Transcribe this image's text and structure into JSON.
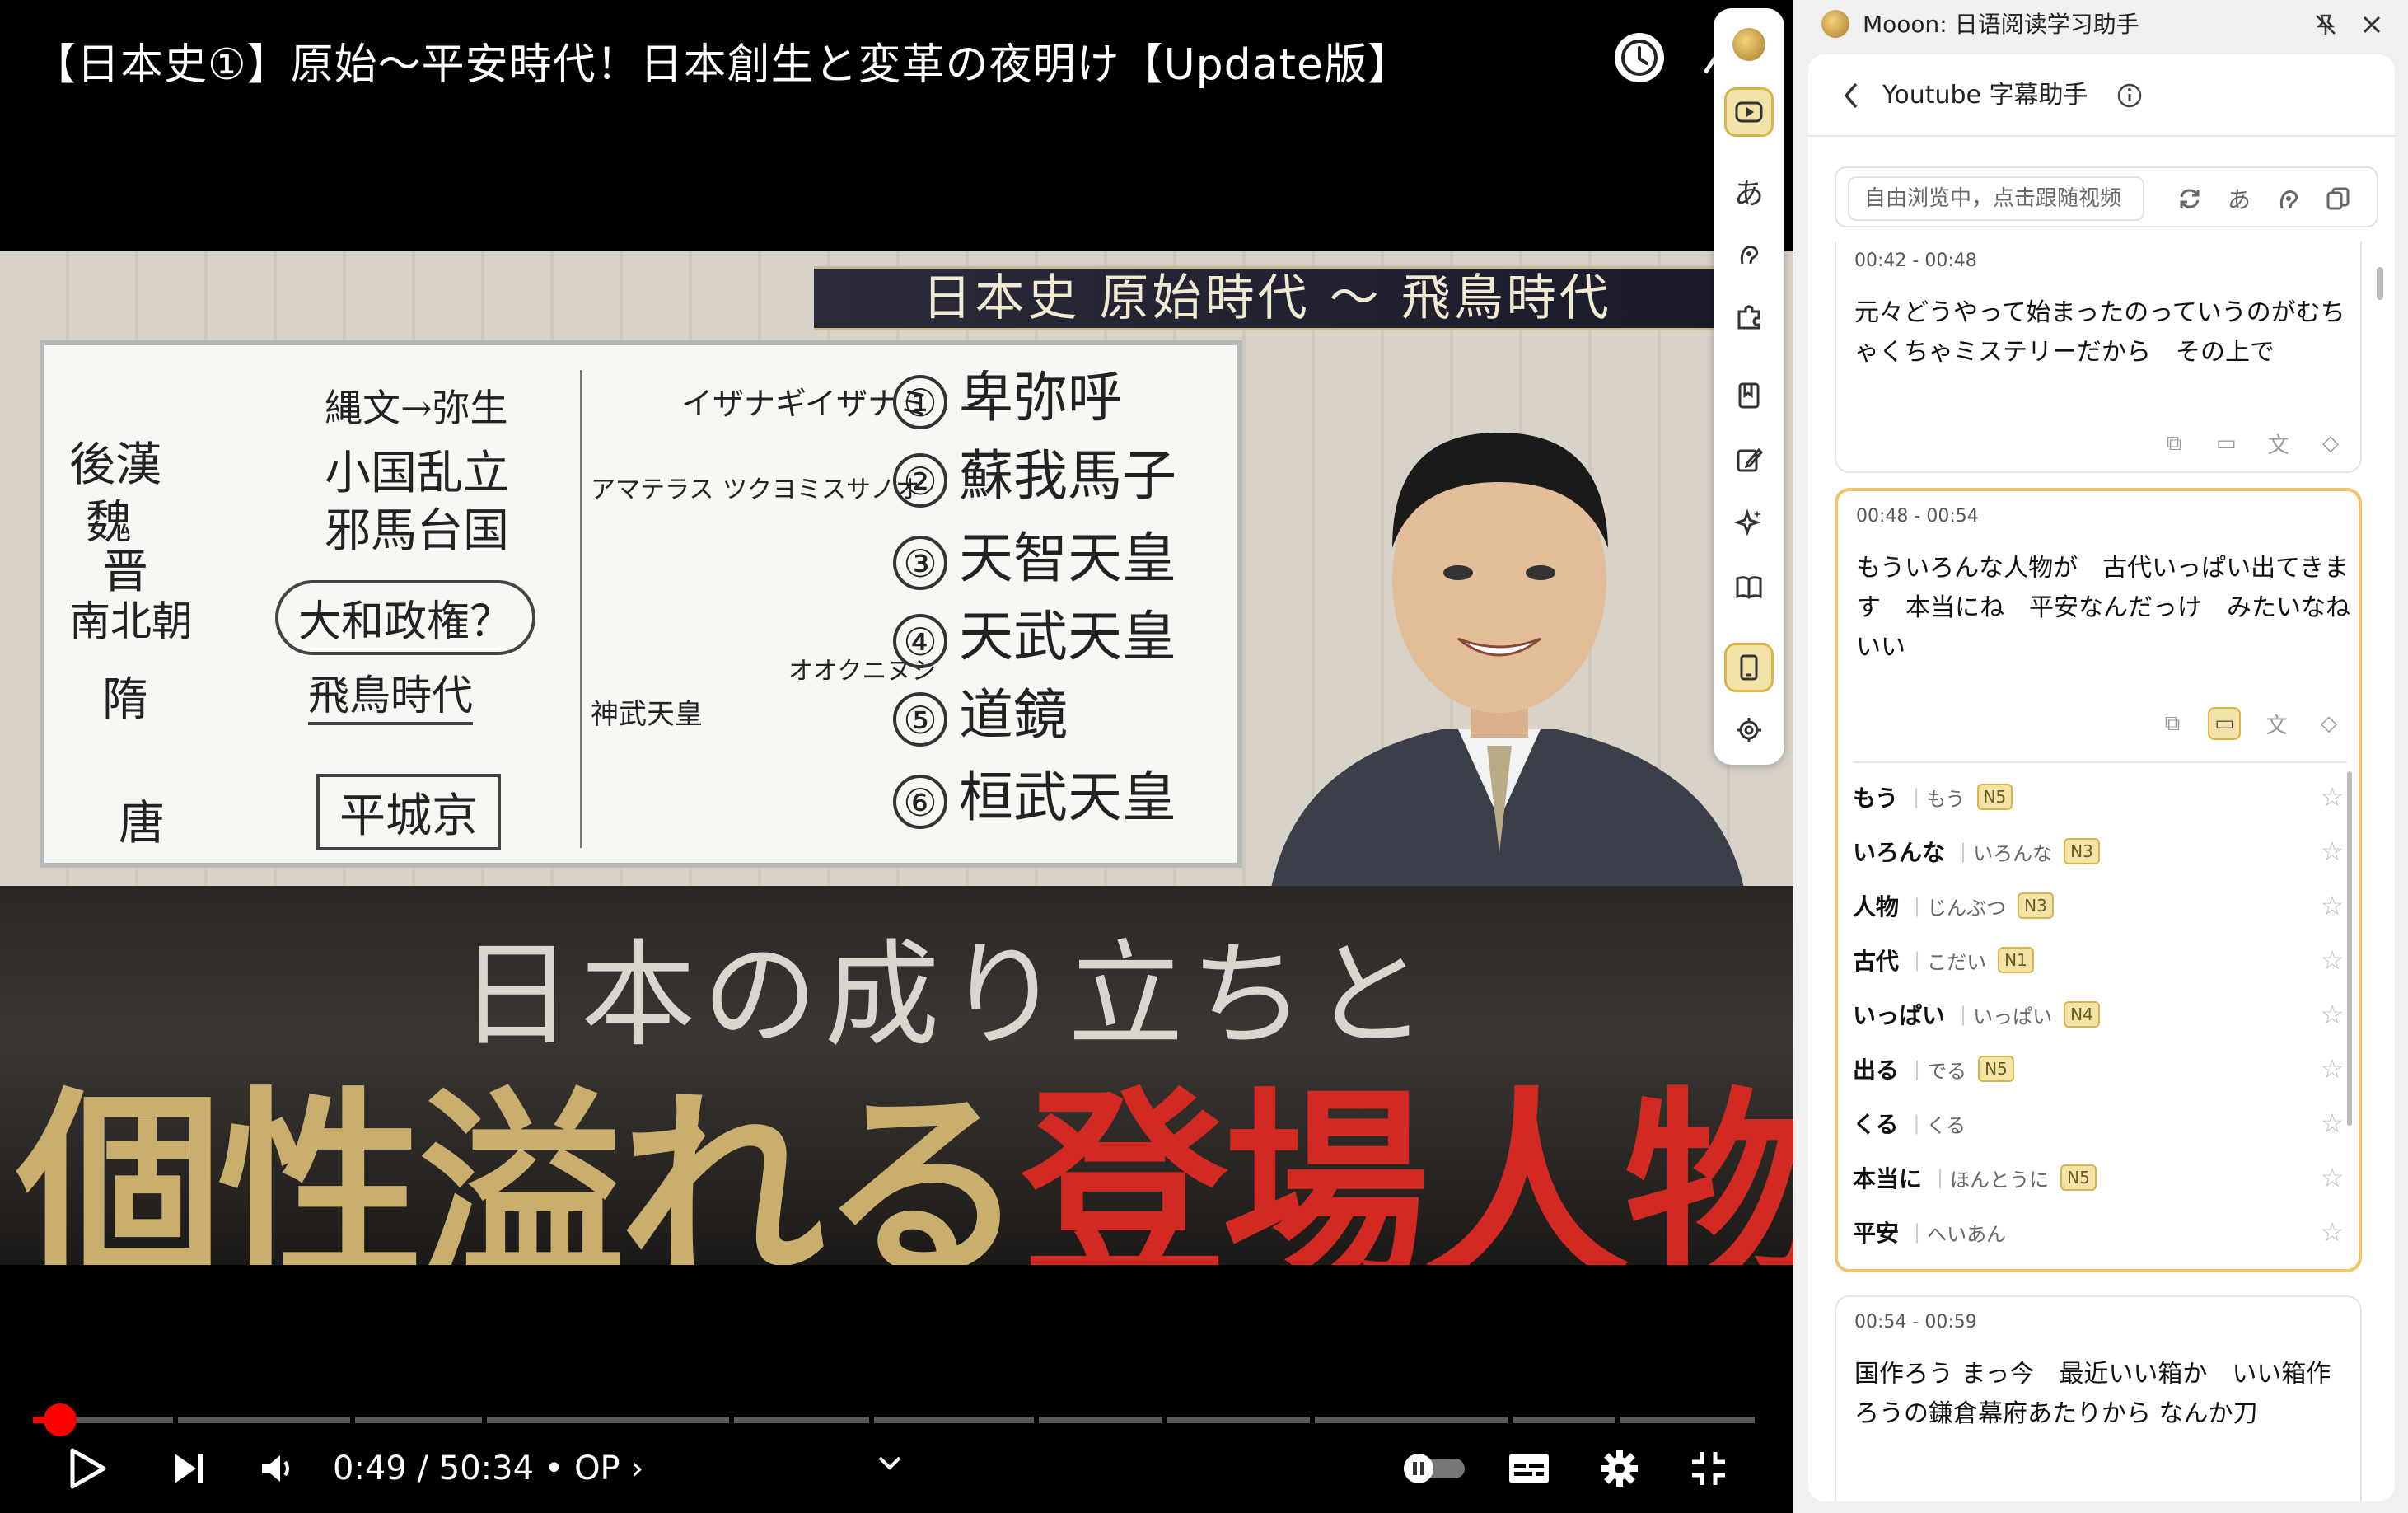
{
  "video": {
    "title": "【日本史①】原始〜平安時代！日本創生と変革の夜明け【Update版】",
    "banner": "日本史 原始時代 〜 飛鳥時代",
    "board_left": [
      "縄文→弥生",
      "後漢",
      "小国乱立",
      "魏",
      "邪馬台国",
      "晋",
      "南北朝",
      "大和政権？",
      "隋",
      "飛鳥時代",
      "唐",
      "平城京"
    ],
    "board_mid": [
      "イザナギ",
      "イザナミ",
      "アマテラス",
      "ツクヨミ",
      "スサノオ",
      "神武天皇",
      "オオクニヌシ"
    ],
    "board_right": [
      {
        "num": "①",
        "name": "卑弥呼"
      },
      {
        "num": "②",
        "name": "蘇我馬子"
      },
      {
        "num": "③",
        "name": "天智天皇"
      },
      {
        "num": "④",
        "name": "天武天皇"
      },
      {
        "num": "⑤",
        "name": "道鏡"
      },
      {
        "num": "⑥",
        "name": "桓武天皇"
      }
    ],
    "headline_line1": "日本の成り立ちと",
    "headline_gold": "個性溢れる",
    "headline_red": "登場人物",
    "time_current": "0:49",
    "time_total": "50:34",
    "chapter": "OP",
    "progress_fraction": 0.016
  },
  "toolstrip": {
    "tools": [
      "logo-icon",
      "youtube-icon",
      "kana-icon",
      "listen-icon",
      "plugin-icon",
      "bookmark-icon",
      "edit-icon",
      "sparkle-icon",
      "book-icon",
      "tablet-icon",
      "settings-icon"
    ],
    "kana_glyph": "あ"
  },
  "panel": {
    "app_title": "Mooon: 日语阅读学习助手",
    "heading": "Youtube 字幕助手",
    "follow_placeholder": "自由浏览中，点击跟随视频",
    "kana_glyph": "あ",
    "subtitles": [
      {
        "time": "00:42 - 00:48",
        "text": "元々どうやって始まったのっていうのがむちゃくちゃミステリーだから　その上で"
      },
      {
        "time": "00:48 - 00:54",
        "text": "もういろんな人物が　古代いっぱい出てきます　本当にね　平安なんだっけ　みたいなね　いい"
      },
      {
        "time": "00:54 - 00:59",
        "text": "国作ろう まっ今　最近いい箱か　いい箱作ろうの鎌倉幕府あたりから なんか刀"
      }
    ],
    "vocab": [
      {
        "word": "もう",
        "reading": "もう",
        "level": "N5"
      },
      {
        "word": "いろんな",
        "reading": "いろんな",
        "level": "N3"
      },
      {
        "word": "人物",
        "reading": "じんぶつ",
        "level": "N3"
      },
      {
        "word": "古代",
        "reading": "こだい",
        "level": "N1"
      },
      {
        "word": "いっぱい",
        "reading": "いっぱい",
        "level": "N4"
      },
      {
        "word": "出る",
        "reading": "でる",
        "level": "N5"
      },
      {
        "word": "くる",
        "reading": "くる",
        "level": ""
      },
      {
        "word": "本当に",
        "reading": "ほんとうに",
        "level": "N5"
      },
      {
        "word": "平安",
        "reading": "へいあん",
        "level": ""
      }
    ]
  },
  "colors": {
    "accent": "#f0c46a",
    "level_bg": "#f3e3a8",
    "progress": "#ff0000",
    "headline_red": "#d22a22",
    "headline_gold": "#c9ae6e"
  }
}
